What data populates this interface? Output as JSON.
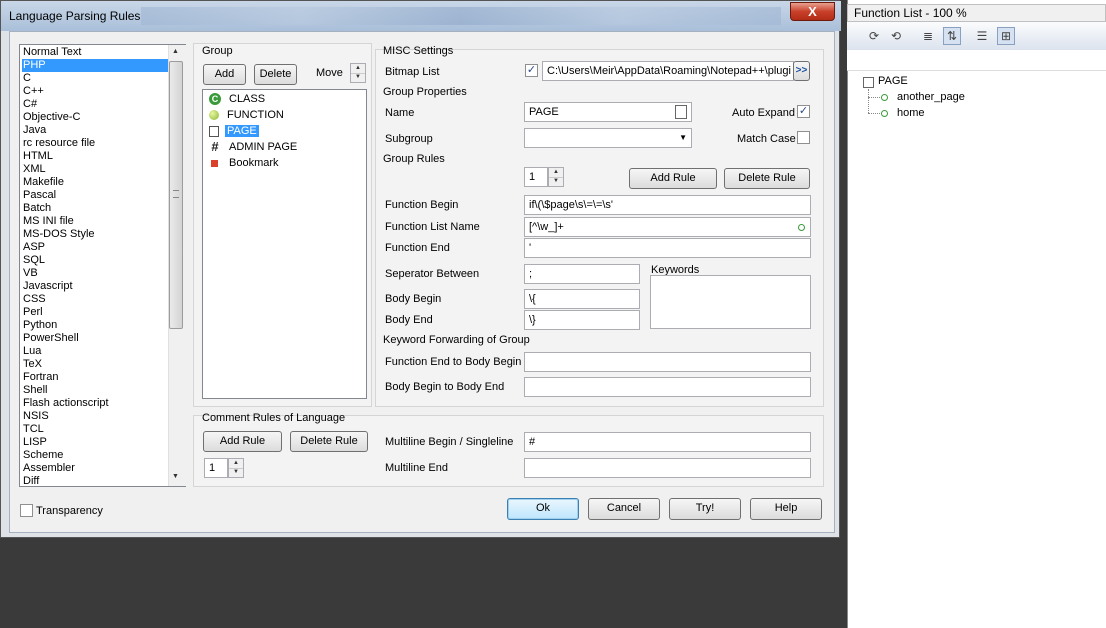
{
  "dialog": {
    "title": "Language Parsing Rules",
    "close_glyph": "X"
  },
  "languages": {
    "selected": "PHP",
    "items": [
      "Normal Text",
      "PHP",
      "C",
      "C++",
      "C#",
      "Objective-C",
      "Java",
      "rc resource file",
      "HTML",
      "XML",
      "Makefile",
      "Pascal",
      "Batch",
      "MS INI file",
      "MS-DOS Style",
      "ASP",
      "SQL",
      "VB",
      "Javascript",
      "CSS",
      "Perl",
      "Python",
      "PowerShell",
      "Lua",
      "TeX",
      "Fortran",
      "Shell",
      "Flash actionscript",
      "NSIS",
      "TCL",
      "LISP",
      "Scheme",
      "Assembler",
      "Diff"
    ]
  },
  "group": {
    "header": "Group",
    "add_label": "Add",
    "delete_label": "Delete",
    "move_label": "Move",
    "items": [
      {
        "label": "CLASS",
        "icon": "class-c-icon",
        "glyph": "C",
        "color": "#3a9a3a"
      },
      {
        "label": "FUNCTION",
        "icon": "function-ball-icon",
        "glyph": "",
        "color": "#8ab833"
      },
      {
        "label": "PAGE",
        "icon": "page-document-icon",
        "glyph": "",
        "color": "#555555"
      },
      {
        "label": "ADMIN PAGE",
        "icon": "hash-icon",
        "glyph": "#",
        "color": "#222222"
      },
      {
        "label": "Bookmark",
        "icon": "bookmark-square-icon",
        "glyph": "",
        "color": "#d9412b"
      }
    ],
    "selected": "PAGE"
  },
  "misc": {
    "header": "MISC Settings",
    "bitmap_label": "Bitmap List",
    "bitmap_checked": true,
    "bitmap_path": "C:\\Users\\Meir\\AppData\\Roaming\\Notepad++\\plugi",
    "browse_glyph": ">>"
  },
  "group_properties": {
    "header": "Group Properties",
    "name_label": "Name",
    "name_value": "PAGE",
    "subgroup_label": "Subgroup",
    "subgroup_value": "",
    "auto_expand_label": "Auto Expand",
    "auto_expand_checked": true,
    "match_case_label": "Match Case",
    "match_case_checked": false
  },
  "group_rules": {
    "header": "Group Rules",
    "rule_index": "1",
    "add_rule_label": "Add Rule",
    "delete_rule_label": "Delete Rule",
    "function_begin_label": "Function Begin",
    "function_begin_value": "if\\(\\$page\\s\\=\\=\\s'",
    "function_list_name_label": "Function List Name",
    "function_list_name_value": "[^\\w_]+",
    "function_end_label": "Function End",
    "function_end_value": "'",
    "separator_label": "Seperator Between",
    "separator_value": ";",
    "keywords_label": "Keywords",
    "body_begin_label": "Body Begin",
    "body_begin_value": "\\{",
    "body_end_label": "Body End",
    "body_end_value": "\\}"
  },
  "keyword_forwarding": {
    "header": "Keyword Forwarding of Group",
    "fe_to_bb_label": "Function End to Body Begin",
    "fe_to_bb_value": "",
    "bb_to_be_label": "Body Begin to Body End",
    "bb_to_be_value": ""
  },
  "comment_rules": {
    "header": "Comment Rules of Language",
    "add_rule_label": "Add Rule",
    "delete_rule_label": "Delete Rule",
    "rule_index": "1",
    "multiline_begin_label": "Multiline Begin / Singleline",
    "multiline_begin_value": "#",
    "multiline_end_label": "Multiline End",
    "multiline_end_value": ""
  },
  "footer": {
    "transparency_label": "Transparency",
    "transparency_checked": false,
    "ok_label": "Ok",
    "cancel_label": "Cancel",
    "try_label": "Try!",
    "help_label": "Help"
  },
  "function_list": {
    "title": "Function List - 100 %",
    "root": "PAGE",
    "children": [
      "another_page",
      "home"
    ]
  }
}
